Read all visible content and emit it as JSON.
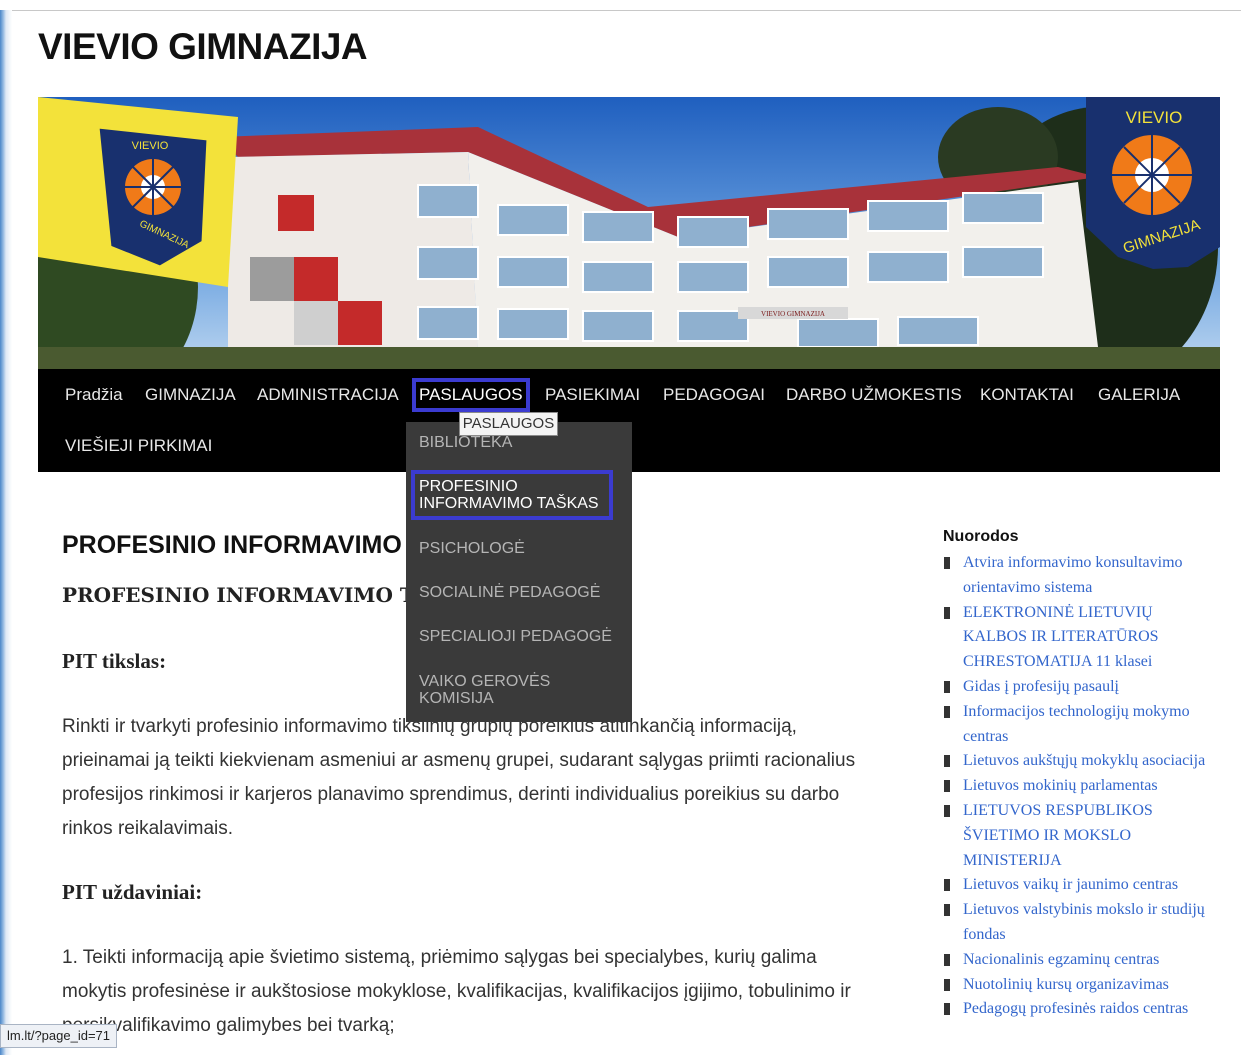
{
  "site": {
    "title": "VIEVIO GIMNAZIJA"
  },
  "banner": {
    "flag_left": {
      "top_text": "VIEVIO",
      "bottom_text": "GIMNAZIJA"
    },
    "emblem_right": {
      "top_text": "VIEVIO",
      "bottom_text": "GIMNAZIJA"
    },
    "building_sign": "VIEVIO GIMNAZIJA"
  },
  "nav": {
    "items": [
      {
        "label": "Pradžia"
      },
      {
        "label": "GIMNAZIJA"
      },
      {
        "label": "ADMINISTRACIJA"
      },
      {
        "label": "PASLAUGOS"
      },
      {
        "label": "PASIEKIMAI"
      },
      {
        "label": "PEDAGOGAI"
      },
      {
        "label": "DARBO UŽMOKESTIS"
      },
      {
        "label": "KONTAKTAI"
      },
      {
        "label": "GALERIJA"
      },
      {
        "label": "VIEŠIEJI PIRKIMAI"
      }
    ],
    "tooltip": "PASLAUGOS",
    "dropdown": [
      {
        "label": "BIBLIOTEKA"
      },
      {
        "label": "PROFESINIO INFORMAVIMO TAŠKAS"
      },
      {
        "label": "PSICHOLOGĖ"
      },
      {
        "label": "SOCIALINĖ PEDAGOGĖ"
      },
      {
        "label": "SPECIALIOJI PEDAGOGĖ"
      },
      {
        "label": "VAIKO GEROVĖS KOMISIJA"
      }
    ]
  },
  "content": {
    "heading": "PROFESINIO INFORMAVIMO TAŠKAS",
    "subheading": "PROFESINIO INFORMAVIMO TAŠKAS",
    "goal_title": "PIT tikslas:",
    "goal_text": "Rinkti ir tvarkyti profesinio informavimo tikslinių grupių poreikius atitinkančią informaciją, prieinamai ją teikti kiekvienam asmeniui ar asmenų grupei, sudarant sąlygas priimti racionalius profesijos rinkimosi ir karjeros planavimo sprendimus, derinti individualius poreikius su darbo rinkos reikalavimais.",
    "tasks_title": "PIT uždaviniai:",
    "task_1": "1.   Teikti informaciją apie švietimo sistemą, priėmimo sąlygas bei specialybes, kurių galima mokytis profesinėse ir aukštosiose mokyklose, kvalifikacijas, kvalifikacijos įgijimo, tobulinimo ir persikvalifikavimo galimybes bei tvarką;"
  },
  "sidebar": {
    "title": "Nuorodos",
    "links": [
      "Atvira informavimo konsultavimo orientavimo sistema",
      "ELEKTRONINĖ LIETUVIŲ KALBOS IR LITERATŪROS CHRESTOMATIJA 11 klasei",
      "Gidas į profesijų pasaulį",
      "Informacijos technologijų mokymo centras",
      "Lietuvos aukštųjų mokyklų asociacija",
      "Lietuvos mokinių parlamentas",
      "LIETUVOS RESPUBLIKOS ŠVIETIMO IR MOKSLO MINISTERIJA",
      "Lietuvos vaikų ir jaunimo centras",
      "Lietuvos valstybinis mokslo ir studijų fondas",
      "Nacionalinis egzaminų centras",
      "Nuotolinių kursų organizavimas",
      "Pedagogų profesinės raidos centras"
    ]
  },
  "status_bar": {
    "url": "lm.lt/?page_id=71"
  },
  "colors": {
    "nav_bg": "#000000",
    "dropdown_bg": "#3a3a3a",
    "highlight": "#3b3bd0",
    "link": "#3366cc"
  }
}
